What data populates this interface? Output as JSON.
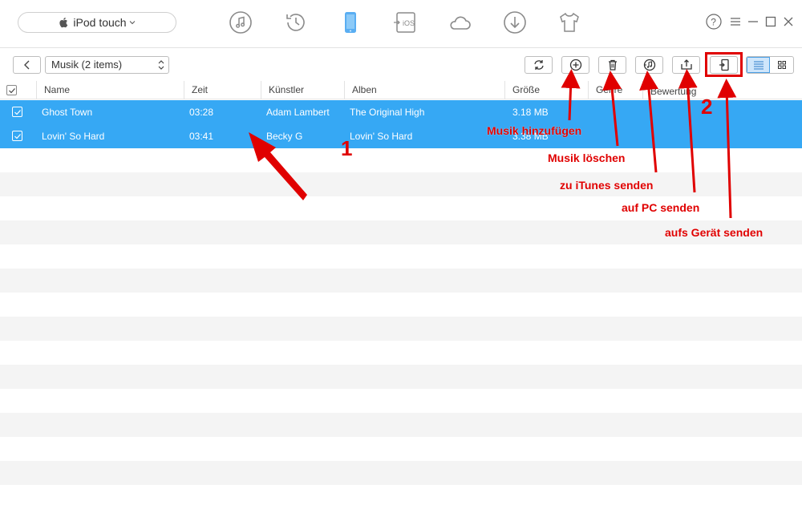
{
  "topbar": {
    "device_name": "iPod touch",
    "nav_icons": [
      "music-icon",
      "history-icon",
      "device-icon",
      "ios-mover-icon",
      "cloud-icon",
      "download-icon",
      "tshirt-icon"
    ],
    "active_nav": "device-icon",
    "accent": "#36a8f4",
    "window_controls": [
      "help-icon",
      "menu-icon",
      "minimize-icon",
      "maximize-icon",
      "close-icon"
    ]
  },
  "toolbar": {
    "category": "Musik (2 items)",
    "buttons": [
      "refresh-icon",
      "add-icon",
      "delete-icon",
      "to-itunes-icon",
      "to-pc-icon",
      "to-device-icon"
    ],
    "view_modes": [
      "list-view-icon",
      "grid-view-icon"
    ],
    "active_view": "list-view-icon"
  },
  "table": {
    "columns": [
      "Name",
      "Zeit",
      "Künstler",
      "Alben",
      "Größe",
      "Genre",
      "Bewertung"
    ],
    "rows": [
      {
        "name": "Ghost Town",
        "time": "03:28",
        "artist": "Adam Lambert",
        "album": "The Original High",
        "size": "3.18 MB",
        "checked": true
      },
      {
        "name": "Lovin' So Hard",
        "time": "03:41",
        "artist": "Becky G",
        "album": "Lovin' So Hard",
        "size": "3.38 MB",
        "checked": true
      }
    ],
    "selected_color": "#36a8f4"
  },
  "annotations": {
    "num1": "1",
    "num2": "2",
    "add": "Musik hinzufügen",
    "delete": "Musik löschen",
    "itunes": "zu iTunes senden",
    "pc": "auf PC senden",
    "device": "aufs Gerät senden",
    "color": "#e00000"
  }
}
